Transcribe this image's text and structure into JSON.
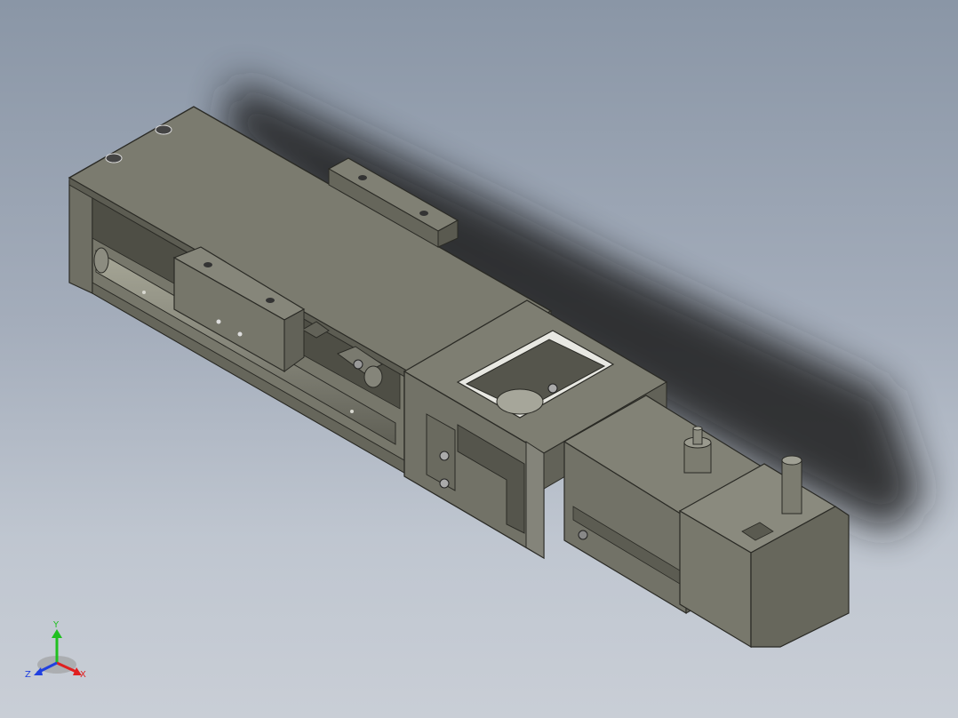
{
  "viewport": {
    "background_top": "#8a96a6",
    "background_bottom": "#c9ced6",
    "part_color": "#7b7b6e",
    "shadow_color": "#1a1a1a"
  },
  "triad": {
    "x_label": "X",
    "y_label": "Y",
    "z_label": "Z",
    "x_color": "#e02020",
    "y_color": "#20c020",
    "z_color": "#2040e0"
  }
}
